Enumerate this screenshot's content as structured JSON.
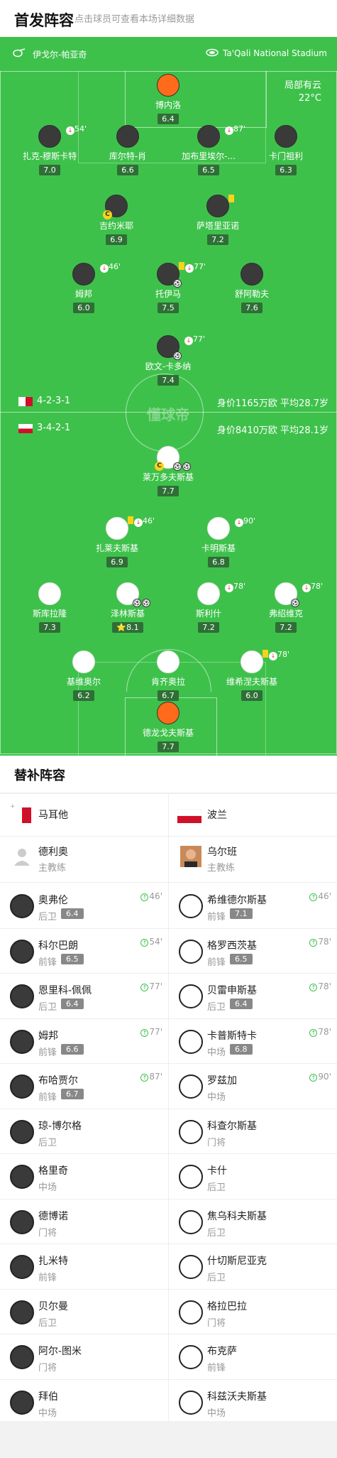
{
  "header": {
    "title": "首发阵容",
    "subtitle": "点击球员可查看本场详细数据"
  },
  "pitch": {
    "home_team": "伊戈尔-帕亚奇",
    "stadium": "Ta'Qali National Stadium",
    "weather": "局部有云",
    "temperature": "22°C",
    "watermark": "懂球帝",
    "team_a": {
      "formation": "4-2-3-1",
      "stats": "身价1165万欧 平均28.7岁",
      "flag": "malta"
    },
    "team_b": {
      "formation": "3-4-2-1",
      "stats": "身价8410万欧 平均28.1岁",
      "flag": "poland"
    },
    "players": [
      {
        "name": "博内洛",
        "rating": "6.4",
        "kit": "orange",
        "sub": ""
      },
      {
        "name": "扎克-穆斯卡特",
        "rating": "7.0",
        "kit": "dark",
        "sub": "54'"
      },
      {
        "name": "库尔特-肖",
        "rating": "6.6",
        "kit": "dark",
        "sub": ""
      },
      {
        "name": "加布里埃尔-...",
        "rating": "6.5",
        "kit": "dark",
        "sub": "87'"
      },
      {
        "name": "卡门祖利",
        "rating": "6.3",
        "kit": "dark",
        "sub": ""
      },
      {
        "name": "吉约米耶",
        "rating": "6.9",
        "kit": "dark",
        "sub": "",
        "captain": "C"
      },
      {
        "name": "萨塔里亚诺",
        "rating": "7.2",
        "kit": "dark",
        "sub": ""
      },
      {
        "name": "姆邦",
        "rating": "6.0",
        "kit": "dark",
        "sub": "46'"
      },
      {
        "name": "托伊马",
        "rating": "7.5",
        "kit": "dark",
        "sub": "77'"
      },
      {
        "name": "舒阿勒夫",
        "rating": "7.6",
        "kit": "dark",
        "sub": ""
      },
      {
        "name": "欧文-卡多纳",
        "rating": "7.4",
        "kit": "dark",
        "sub": "77'"
      },
      {
        "name": "莱万多夫斯基",
        "rating": "7.7",
        "kit": "white",
        "sub": "",
        "captain": "C"
      },
      {
        "name": "扎莱夫斯基",
        "rating": "6.9",
        "kit": "white",
        "sub": "46'"
      },
      {
        "name": "卡明斯基",
        "rating": "6.8",
        "kit": "white",
        "sub": "90'"
      },
      {
        "name": "斯库拉隆",
        "rating": "7.3",
        "kit": "white",
        "sub": ""
      },
      {
        "name": "泽林斯基",
        "rating": "8.1",
        "kit": "white",
        "sub": "",
        "star": "⭐"
      },
      {
        "name": "斯利什",
        "rating": "7.2",
        "kit": "white",
        "sub": "78'"
      },
      {
        "name": "弗绍维克",
        "rating": "7.2",
        "kit": "white",
        "sub": "78'"
      },
      {
        "name": "基维奥尔",
        "rating": "6.2",
        "kit": "white",
        "sub": ""
      },
      {
        "name": "肯齐奥拉",
        "rating": "6.7",
        "kit": "white",
        "sub": ""
      },
      {
        "name": "维希涅夫斯基",
        "rating": "6.0",
        "kit": "white",
        "sub": "78'"
      },
      {
        "name": "德龙戈夫斯基",
        "rating": "7.7",
        "kit": "orange",
        "sub": ""
      }
    ]
  },
  "subs": {
    "title": "替补阵容",
    "left_team": "马耳他",
    "right_team": "波兰",
    "left_coach": {
      "name": "德利奥",
      "role": "主教练"
    },
    "right_coach": {
      "name": "乌尔班",
      "role": "主教练"
    },
    "left": [
      {
        "name": "奥弗伦",
        "pos": "后卫",
        "rating": "6.4",
        "minute": "46'"
      },
      {
        "name": "科尔巴朗",
        "pos": "前锋",
        "rating": "6.5",
        "minute": "54'"
      },
      {
        "name": "恩里科-佩佩",
        "pos": "后卫",
        "rating": "6.4",
        "minute": "77'"
      },
      {
        "name": "姆邦",
        "pos": "前锋",
        "rating": "6.6",
        "minute": "77'"
      },
      {
        "name": "布哈贾尔",
        "pos": "前锋",
        "rating": "6.7",
        "minute": "87'"
      },
      {
        "name": "琼-博尔格",
        "pos": "后卫",
        "rating": "",
        "minute": ""
      },
      {
        "name": "格里奇",
        "pos": "中场",
        "rating": "",
        "minute": ""
      },
      {
        "name": "德博诺",
        "pos": "门将",
        "rating": "",
        "minute": ""
      },
      {
        "name": "扎米特",
        "pos": "前锋",
        "rating": "",
        "minute": ""
      },
      {
        "name": "贝尔曼",
        "pos": "后卫",
        "rating": "",
        "minute": ""
      },
      {
        "name": "阿尔-图米",
        "pos": "门将",
        "rating": "",
        "minute": ""
      },
      {
        "name": "拜伯",
        "pos": "中场",
        "rating": "",
        "minute": ""
      }
    ],
    "right": [
      {
        "name": "希维德尔斯基",
        "pos": "前锋",
        "rating": "7.1",
        "minute": "46'"
      },
      {
        "name": "格罗西茨基",
        "pos": "前锋",
        "rating": "6.5",
        "minute": "78'"
      },
      {
        "name": "贝雷申斯基",
        "pos": "后卫",
        "rating": "6.4",
        "minute": "78'"
      },
      {
        "name": "卡普斯特卡",
        "pos": "中场",
        "rating": "6.8",
        "minute": "78'"
      },
      {
        "name": "罗兹加",
        "pos": "中场",
        "rating": "",
        "minute": "90'"
      },
      {
        "name": "科查尔斯基",
        "pos": "门将",
        "rating": "",
        "minute": ""
      },
      {
        "name": "卡什",
        "pos": "后卫",
        "rating": "",
        "minute": ""
      },
      {
        "name": "焦乌科夫斯基",
        "pos": "后卫",
        "rating": "",
        "minute": ""
      },
      {
        "name": "什切斯尼亚克",
        "pos": "后卫",
        "rating": "",
        "minute": ""
      },
      {
        "name": "格拉巴拉",
        "pos": "门将",
        "rating": "",
        "minute": ""
      },
      {
        "name": "布克萨",
        "pos": "前锋",
        "rating": "",
        "minute": ""
      },
      {
        "name": "科兹沃夫斯基",
        "pos": "中场",
        "rating": "",
        "minute": ""
      }
    ]
  },
  "colors": {
    "pitch": "#3ec14b",
    "rating_bg": "#2f6e36",
    "goal_green": "#3ec14b",
    "sub_red": "#e03a3a",
    "yellow": "#f8d31a"
  }
}
